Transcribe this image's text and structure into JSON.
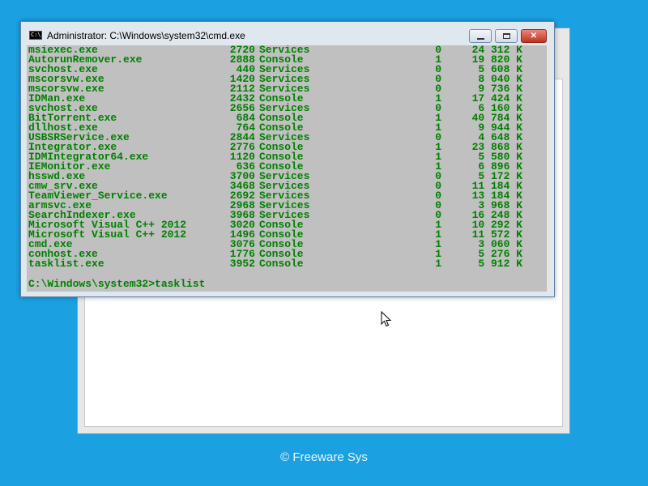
{
  "window": {
    "title": "Administrator: C:\\Windows\\system32\\cmd.exe",
    "icon_text": "C:\\"
  },
  "controls": {
    "minimize": "minimize-icon",
    "maximize": "maximize-icon",
    "close_label": "✕"
  },
  "processes": [
    {
      "name": "msiexec.exe",
      "pid": "2720",
      "session": "Services",
      "num": "0",
      "mem": "24 312 K"
    },
    {
      "name": "AutorunRemover.exe",
      "pid": "2888",
      "session": "Console",
      "num": "1",
      "mem": "19 820 K"
    },
    {
      "name": "svchost.exe",
      "pid": "440",
      "session": "Services",
      "num": "0",
      "mem": "5 608 K"
    },
    {
      "name": "mscorsvw.exe",
      "pid": "1420",
      "session": "Services",
      "num": "0",
      "mem": "8 040 K"
    },
    {
      "name": "mscorsvw.exe",
      "pid": "2112",
      "session": "Services",
      "num": "0",
      "mem": "9 736 K"
    },
    {
      "name": "IDMan.exe",
      "pid": "2432",
      "session": "Console",
      "num": "1",
      "mem": "17 424 K"
    },
    {
      "name": "svchost.exe",
      "pid": "2656",
      "session": "Services",
      "num": "0",
      "mem": "6 160 K"
    },
    {
      "name": "BitTorrent.exe",
      "pid": "684",
      "session": "Console",
      "num": "1",
      "mem": "40 784 K"
    },
    {
      "name": "dllhost.exe",
      "pid": "764",
      "session": "Console",
      "num": "1",
      "mem": "9 944 K"
    },
    {
      "name": "USBSRService.exe",
      "pid": "2844",
      "session": "Services",
      "num": "0",
      "mem": "4 648 K"
    },
    {
      "name": "Integrator.exe",
      "pid": "2776",
      "session": "Console",
      "num": "1",
      "mem": "23 868 K"
    },
    {
      "name": "IDMIntegrator64.exe",
      "pid": "1120",
      "session": "Console",
      "num": "1",
      "mem": "5 580 K"
    },
    {
      "name": "IEMonitor.exe",
      "pid": "636",
      "session": "Console",
      "num": "1",
      "mem": "6 896 K"
    },
    {
      "name": "hsswd.exe",
      "pid": "3700",
      "session": "Services",
      "num": "0",
      "mem": "5 172 K"
    },
    {
      "name": "cmw_srv.exe",
      "pid": "3468",
      "session": "Services",
      "num": "0",
      "mem": "11 184 K"
    },
    {
      "name": "TeamViewer_Service.exe",
      "pid": "2692",
      "session": "Services",
      "num": "0",
      "mem": "13 184 K"
    },
    {
      "name": "armsvc.exe",
      "pid": "2968",
      "session": "Services",
      "num": "0",
      "mem": "3 968 K"
    },
    {
      "name": "SearchIndexer.exe",
      "pid": "3968",
      "session": "Services",
      "num": "0",
      "mem": "16 248 K"
    },
    {
      "name": "Microsoft Visual C++ 2012",
      "pid": "3020",
      "session": "Console",
      "num": "1",
      "mem": "10 292 K"
    },
    {
      "name": "Microsoft Visual C++ 2012",
      "pid": "1496",
      "session": "Console",
      "num": "1",
      "mem": "11 572 K"
    },
    {
      "name": "cmd.exe",
      "pid": "3076",
      "session": "Console",
      "num": "1",
      "mem": "3 060 K"
    },
    {
      "name": "conhost.exe",
      "pid": "1776",
      "session": "Console",
      "num": "1",
      "mem": "5 276 K"
    },
    {
      "name": "tasklist.exe",
      "pid": "3952",
      "session": "Console",
      "num": "1",
      "mem": "5 912 K"
    }
  ],
  "prompt": "C:\\Windows\\system32>tasklist",
  "footer": "©  Freeware Sys",
  "colors": {
    "desktop": "#1ba1e2",
    "console_bg": "#c0c0c0",
    "console_text": "#008000"
  }
}
